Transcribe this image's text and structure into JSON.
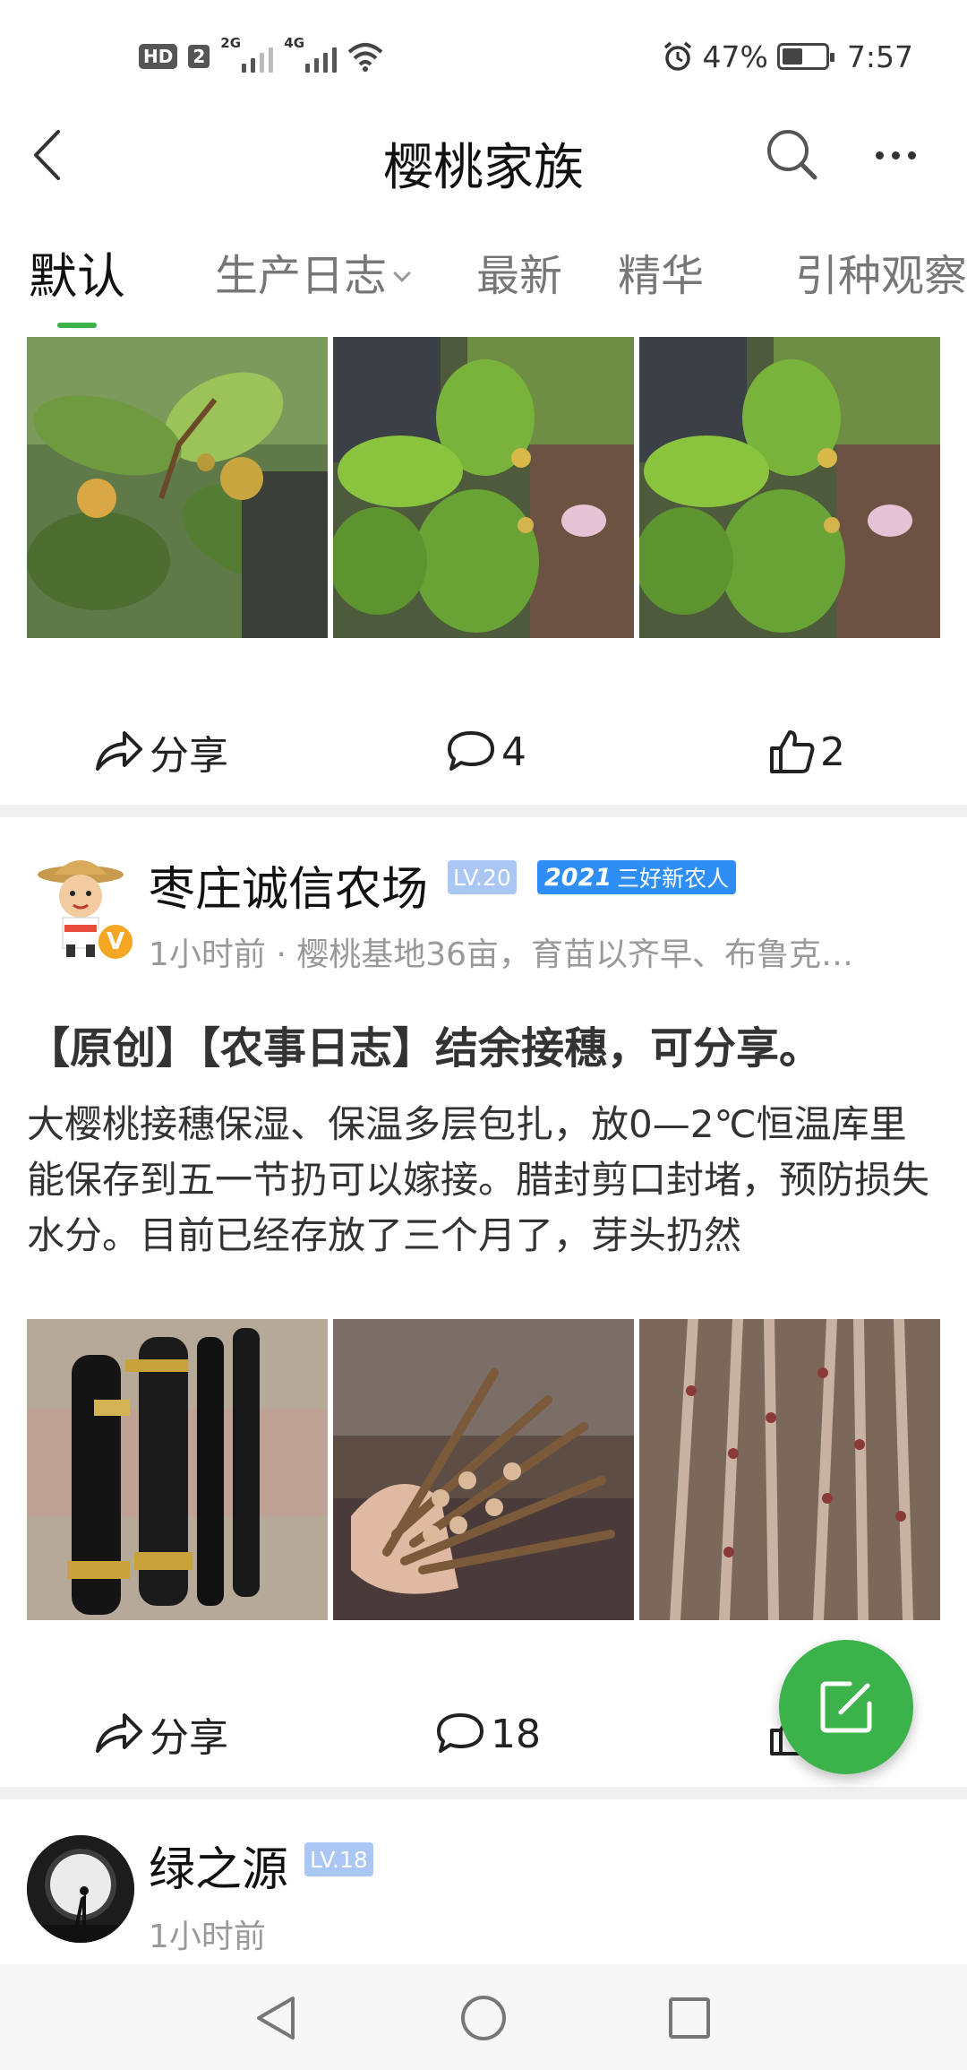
{
  "status_bar": {
    "left_label": "HD",
    "sim2": "2",
    "net1": "2G",
    "net2": "4G",
    "battery": "47%",
    "battery_level": 0.47,
    "time": "7:57"
  },
  "header": {
    "title": "樱桃家族"
  },
  "tabs": [
    {
      "label": "默认"
    },
    {
      "label": "生产日志"
    },
    {
      "label": "最新"
    },
    {
      "label": "精华"
    },
    {
      "label": "引种观察"
    }
  ],
  "posts": [
    {
      "share_label": "分享",
      "comment_count": "4",
      "like_count": "2"
    },
    {
      "author": "枣庄诚信农场",
      "level": "LV.20",
      "badge_year": "2021",
      "badge_text": "三好新农人",
      "meta": "1小时前 · 樱桃基地36亩，育苗以齐早、布鲁克…",
      "title": "【原创】【农事日志】结余接穗，可分享。",
      "body": "大樱桃接穗保湿、保温多层包扎，放0—2℃恒温库里能保存到五一节扔可以嫁接。腊封剪口封堵，预防损失水分。目前已经存放了三个月了，芽头扔然",
      "share_label": "分享",
      "comment_count": "18"
    },
    {
      "author": "绿之源",
      "level": "LV.18",
      "meta": "1小时前"
    }
  ],
  "colors": {
    "accent": "#3cb34a",
    "level_badge": "#a9c7f2",
    "year_badge": "#2f8ef5",
    "verified": "#f5a623"
  }
}
